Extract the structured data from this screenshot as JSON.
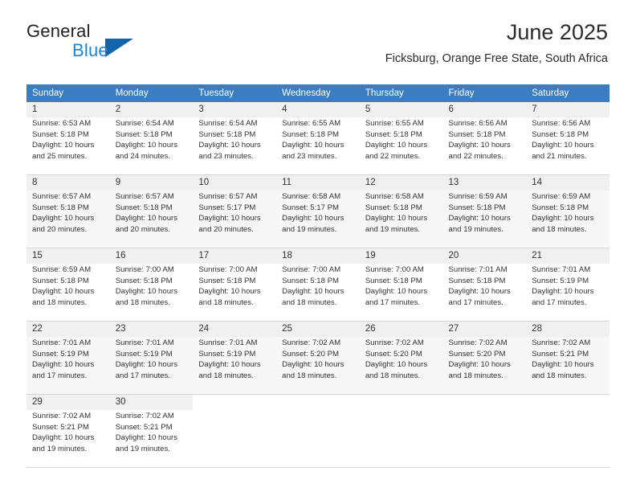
{
  "brand": {
    "name_top": "General",
    "name_bottom": "Blue",
    "logo_icon": "triangle-logo-icon"
  },
  "header": {
    "month_title": "June 2025",
    "location": "Ficksburg, Orange Free State, South Africa"
  },
  "calendar": {
    "weekday_headers": [
      "Sunday",
      "Monday",
      "Tuesday",
      "Wednesday",
      "Thursday",
      "Friday",
      "Saturday"
    ],
    "labels": {
      "sunrise": "Sunrise:",
      "sunset": "Sunset:",
      "daylight": "Daylight:"
    },
    "weeks": [
      {
        "shaded": false,
        "days": [
          {
            "day": "1",
            "sunrise": "Sunrise: 6:53 AM",
            "sunset": "Sunset: 5:18 PM",
            "daylight_line1": "Daylight: 10 hours",
            "daylight_line2": "and 25 minutes."
          },
          {
            "day": "2",
            "sunrise": "Sunrise: 6:54 AM",
            "sunset": "Sunset: 5:18 PM",
            "daylight_line1": "Daylight: 10 hours",
            "daylight_line2": "and 24 minutes."
          },
          {
            "day": "3",
            "sunrise": "Sunrise: 6:54 AM",
            "sunset": "Sunset: 5:18 PM",
            "daylight_line1": "Daylight: 10 hours",
            "daylight_line2": "and 23 minutes."
          },
          {
            "day": "4",
            "sunrise": "Sunrise: 6:55 AM",
            "sunset": "Sunset: 5:18 PM",
            "daylight_line1": "Daylight: 10 hours",
            "daylight_line2": "and 23 minutes."
          },
          {
            "day": "5",
            "sunrise": "Sunrise: 6:55 AM",
            "sunset": "Sunset: 5:18 PM",
            "daylight_line1": "Daylight: 10 hours",
            "daylight_line2": "and 22 minutes."
          },
          {
            "day": "6",
            "sunrise": "Sunrise: 6:56 AM",
            "sunset": "Sunset: 5:18 PM",
            "daylight_line1": "Daylight: 10 hours",
            "daylight_line2": "and 22 minutes."
          },
          {
            "day": "7",
            "sunrise": "Sunrise: 6:56 AM",
            "sunset": "Sunset: 5:18 PM",
            "daylight_line1": "Daylight: 10 hours",
            "daylight_line2": "and 21 minutes."
          }
        ]
      },
      {
        "shaded": true,
        "days": [
          {
            "day": "8",
            "sunrise": "Sunrise: 6:57 AM",
            "sunset": "Sunset: 5:18 PM",
            "daylight_line1": "Daylight: 10 hours",
            "daylight_line2": "and 20 minutes."
          },
          {
            "day": "9",
            "sunrise": "Sunrise: 6:57 AM",
            "sunset": "Sunset: 5:18 PM",
            "daylight_line1": "Daylight: 10 hours",
            "daylight_line2": "and 20 minutes."
          },
          {
            "day": "10",
            "sunrise": "Sunrise: 6:57 AM",
            "sunset": "Sunset: 5:17 PM",
            "daylight_line1": "Daylight: 10 hours",
            "daylight_line2": "and 20 minutes."
          },
          {
            "day": "11",
            "sunrise": "Sunrise: 6:58 AM",
            "sunset": "Sunset: 5:17 PM",
            "daylight_line1": "Daylight: 10 hours",
            "daylight_line2": "and 19 minutes."
          },
          {
            "day": "12",
            "sunrise": "Sunrise: 6:58 AM",
            "sunset": "Sunset: 5:18 PM",
            "daylight_line1": "Daylight: 10 hours",
            "daylight_line2": "and 19 minutes."
          },
          {
            "day": "13",
            "sunrise": "Sunrise: 6:59 AM",
            "sunset": "Sunset: 5:18 PM",
            "daylight_line1": "Daylight: 10 hours",
            "daylight_line2": "and 19 minutes."
          },
          {
            "day": "14",
            "sunrise": "Sunrise: 6:59 AM",
            "sunset": "Sunset: 5:18 PM",
            "daylight_line1": "Daylight: 10 hours",
            "daylight_line2": "and 18 minutes."
          }
        ]
      },
      {
        "shaded": false,
        "days": [
          {
            "day": "15",
            "sunrise": "Sunrise: 6:59 AM",
            "sunset": "Sunset: 5:18 PM",
            "daylight_line1": "Daylight: 10 hours",
            "daylight_line2": "and 18 minutes."
          },
          {
            "day": "16",
            "sunrise": "Sunrise: 7:00 AM",
            "sunset": "Sunset: 5:18 PM",
            "daylight_line1": "Daylight: 10 hours",
            "daylight_line2": "and 18 minutes."
          },
          {
            "day": "17",
            "sunrise": "Sunrise: 7:00 AM",
            "sunset": "Sunset: 5:18 PM",
            "daylight_line1": "Daylight: 10 hours",
            "daylight_line2": "and 18 minutes."
          },
          {
            "day": "18",
            "sunrise": "Sunrise: 7:00 AM",
            "sunset": "Sunset: 5:18 PM",
            "daylight_line1": "Daylight: 10 hours",
            "daylight_line2": "and 18 minutes."
          },
          {
            "day": "19",
            "sunrise": "Sunrise: 7:00 AM",
            "sunset": "Sunset: 5:18 PM",
            "daylight_line1": "Daylight: 10 hours",
            "daylight_line2": "and 17 minutes."
          },
          {
            "day": "20",
            "sunrise": "Sunrise: 7:01 AM",
            "sunset": "Sunset: 5:18 PM",
            "daylight_line1": "Daylight: 10 hours",
            "daylight_line2": "and 17 minutes."
          },
          {
            "day": "21",
            "sunrise": "Sunrise: 7:01 AM",
            "sunset": "Sunset: 5:19 PM",
            "daylight_line1": "Daylight: 10 hours",
            "daylight_line2": "and 17 minutes."
          }
        ]
      },
      {
        "shaded": true,
        "days": [
          {
            "day": "22",
            "sunrise": "Sunrise: 7:01 AM",
            "sunset": "Sunset: 5:19 PM",
            "daylight_line1": "Daylight: 10 hours",
            "daylight_line2": "and 17 minutes."
          },
          {
            "day": "23",
            "sunrise": "Sunrise: 7:01 AM",
            "sunset": "Sunset: 5:19 PM",
            "daylight_line1": "Daylight: 10 hours",
            "daylight_line2": "and 17 minutes."
          },
          {
            "day": "24",
            "sunrise": "Sunrise: 7:01 AM",
            "sunset": "Sunset: 5:19 PM",
            "daylight_line1": "Daylight: 10 hours",
            "daylight_line2": "and 18 minutes."
          },
          {
            "day": "25",
            "sunrise": "Sunrise: 7:02 AM",
            "sunset": "Sunset: 5:20 PM",
            "daylight_line1": "Daylight: 10 hours",
            "daylight_line2": "and 18 minutes."
          },
          {
            "day": "26",
            "sunrise": "Sunrise: 7:02 AM",
            "sunset": "Sunset: 5:20 PM",
            "daylight_line1": "Daylight: 10 hours",
            "daylight_line2": "and 18 minutes."
          },
          {
            "day": "27",
            "sunrise": "Sunrise: 7:02 AM",
            "sunset": "Sunset: 5:20 PM",
            "daylight_line1": "Daylight: 10 hours",
            "daylight_line2": "and 18 minutes."
          },
          {
            "day": "28",
            "sunrise": "Sunrise: 7:02 AM",
            "sunset": "Sunset: 5:21 PM",
            "daylight_line1": "Daylight: 10 hours",
            "daylight_line2": "and 18 minutes."
          }
        ]
      },
      {
        "shaded": false,
        "days": [
          {
            "day": "29",
            "sunrise": "Sunrise: 7:02 AM",
            "sunset": "Sunset: 5:21 PM",
            "daylight_line1": "Daylight: 10 hours",
            "daylight_line2": "and 19 minutes."
          },
          {
            "day": "30",
            "sunrise": "Sunrise: 7:02 AM",
            "sunset": "Sunset: 5:21 PM",
            "daylight_line1": "Daylight: 10 hours",
            "daylight_line2": "and 19 minutes."
          },
          null,
          null,
          null,
          null,
          null
        ]
      }
    ]
  },
  "colors": {
    "header_blue": "#3b7dc0",
    "brand_blue": "#1a86d8",
    "logo_blue": "#1464aa",
    "row_shade": "#f7f7f7",
    "daynum_shade": "#f0f0f0"
  }
}
